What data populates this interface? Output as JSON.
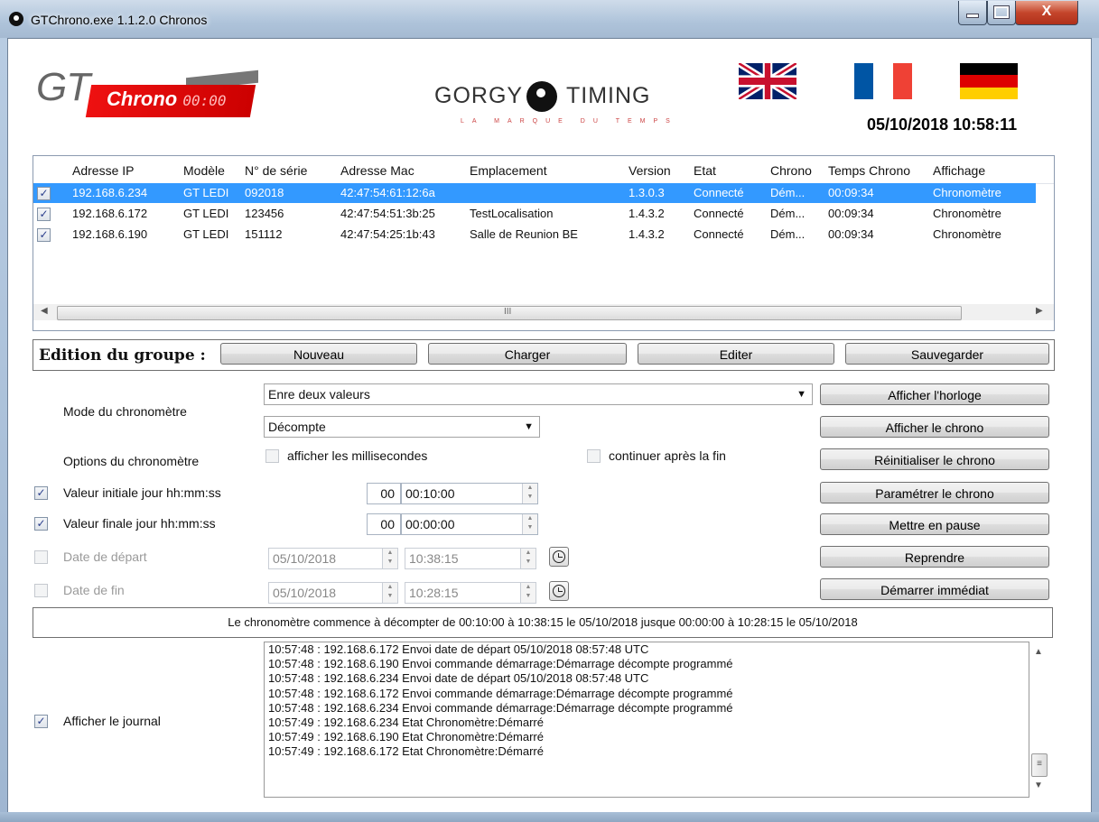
{
  "window": {
    "title": "GTChrono.exe 1.1.2.0 Chronos"
  },
  "header": {
    "brand_gt": "GT",
    "brand_chrono": "Chrono",
    "brand_digits": "00:00",
    "gorgy_left": "GORGY",
    "gorgy_right": "TIMING",
    "gorgy_tagline": "LA MARQUE DU TEMPS",
    "datetime": "05/10/2018 10:58:11",
    "flags": [
      "uk-flag",
      "france-flag",
      "germany-flag"
    ]
  },
  "devices": {
    "columns": [
      "Adresse IP",
      "Modèle",
      "N° de série",
      "Adresse Mac",
      "Emplacement",
      "Version",
      "Etat",
      "Chrono",
      "Temps Chrono",
      "Affichage"
    ],
    "rows": [
      {
        "checked": true,
        "selected": true,
        "ip": "192.168.6.234",
        "model": "GT LEDI",
        "serial": "092018",
        "mac": "42:47:54:61:12:6a",
        "location": "",
        "version": "1.3.0.3",
        "state": "Connecté",
        "chrono": "Dém...",
        "time": "00:09:34",
        "display": "Chronomètre"
      },
      {
        "checked": true,
        "selected": false,
        "ip": "192.168.6.172",
        "model": "GT LEDI",
        "serial": "123456",
        "mac": "42:47:54:51:3b:25",
        "location": "TestLocalisation",
        "version": "1.4.3.2",
        "state": "Connecté",
        "chrono": "Dém...",
        "time": "00:09:34",
        "display": "Chronomètre"
      },
      {
        "checked": true,
        "selected": false,
        "ip": "192.168.6.190",
        "model": "GT LEDI",
        "serial": "151112",
        "mac": "42:47:54:25:1b:43",
        "location": "Salle de Reunion BE",
        "version": "1.4.3.2",
        "state": "Connecté",
        "chrono": "Dém...",
        "time": "00:09:34",
        "display": "Chronomètre"
      }
    ],
    "scroll_mark": "III"
  },
  "group": {
    "label": "Edition du groupe :",
    "new": "Nouveau",
    "load": "Charger",
    "edit": "Editer",
    "save": "Sauvegarder"
  },
  "settings": {
    "mode_label": "Mode du chronomètre",
    "mode_value": "Enre deux valeurs",
    "direction_value": "Décompte",
    "options_label": "Options du chronomètre",
    "show_ms": "afficher les millisecondes",
    "continue_after": "continuer après la fin",
    "initial_label": "Valeur initiale jour hh:mm:ss",
    "initial_days": "00",
    "initial_time": "00:10:00",
    "final_label": "Valeur finale jour hh:mm:ss",
    "final_days": "00",
    "final_time": "00:00:00",
    "start_label": "Date de départ",
    "start_date": "05/10/2018",
    "start_time": "10:38:15",
    "end_label": "Date de fin",
    "end_date": "05/10/2018",
    "end_time": "10:28:15"
  },
  "actions": {
    "show_clock": "Afficher l'horloge",
    "show_chrono": "Afficher le chrono",
    "reset_chrono": "Réinitialiser le chrono",
    "config_chrono": "Paramétrer le chrono",
    "pause": "Mettre en pause",
    "resume": "Reprendre",
    "start_now": "Démarrer immédiat"
  },
  "summary": "Le chronomètre commence à décompter de  00:10:00 à 10:38:15 le 05/10/2018  jusque  00:00:00 à 10:28:15 le 05/10/2018",
  "journal": {
    "label": "Afficher le journal",
    "lines": [
      "10:57:48 :  192.168.6.172 Envoi date de départ 05/10/2018 08:57:48 UTC",
      "10:57:48 :  192.168.6.190 Envoi commande démarrage:Démarrage décompte programmé",
      "10:57:48 :  192.168.6.234 Envoi date de départ 05/10/2018 08:57:48 UTC",
      "10:57:48 :  192.168.6.172 Envoi commande démarrage:Démarrage décompte programmé",
      "10:57:48 :  192.168.6.234 Envoi commande démarrage:Démarrage décompte programmé",
      "10:57:49 :  192.168.6.234 Etat Chronomètre:Démarré",
      "10:57:49 :  192.168.6.190 Etat Chronomètre:Démarré",
      "10:57:49 :  192.168.6.172 Etat Chronomètre:Démarré"
    ]
  },
  "colors": {
    "selection": "#3399ff",
    "brand_red": "#dd1111"
  }
}
